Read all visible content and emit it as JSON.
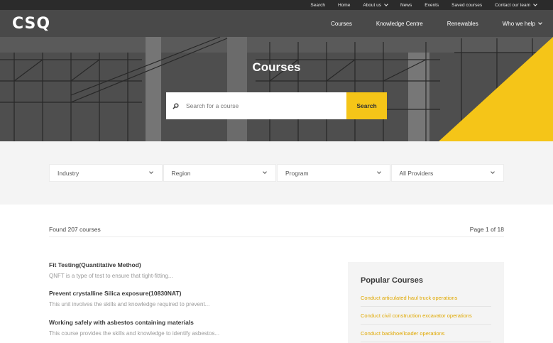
{
  "topbar": {
    "links": [
      "Search",
      "Home",
      "About us",
      "News",
      "Events",
      "Saved courses",
      "Contact our team"
    ]
  },
  "brand": {
    "logo_text": "CSQ",
    "accent": "#f5c518"
  },
  "mainnav": {
    "items": [
      "Courses",
      "Knowledge Centre",
      "Renewables",
      "Who we help"
    ]
  },
  "hero": {
    "title": "Courses",
    "search_placeholder": "Search for a course",
    "search_button": "Search"
  },
  "filters": [
    "Industry",
    "Region",
    "Program",
    "All Providers"
  ],
  "results": {
    "count_text": "Found 207 courses",
    "page_text": "Page 1 of 18",
    "courses": [
      {
        "title": "Fit Testing(Quantitative Method)",
        "desc": "QNFT is a type of test to ensure that tight-fitting..."
      },
      {
        "title": "Prevent crystalline Silica exposure(10830NAT)",
        "desc": "This unit involves the skills and knowledge required to prevent..."
      },
      {
        "title": "Working safely with asbestos containing materials",
        "desc": "This course provides the skills and knowledge to identify asbestos..."
      }
    ]
  },
  "popular": {
    "title": "Popular Courses",
    "items": [
      "Conduct articulated haul truck operations",
      "Conduct civil construction excavator operations",
      "Conduct backhoe/loader operations"
    ]
  }
}
